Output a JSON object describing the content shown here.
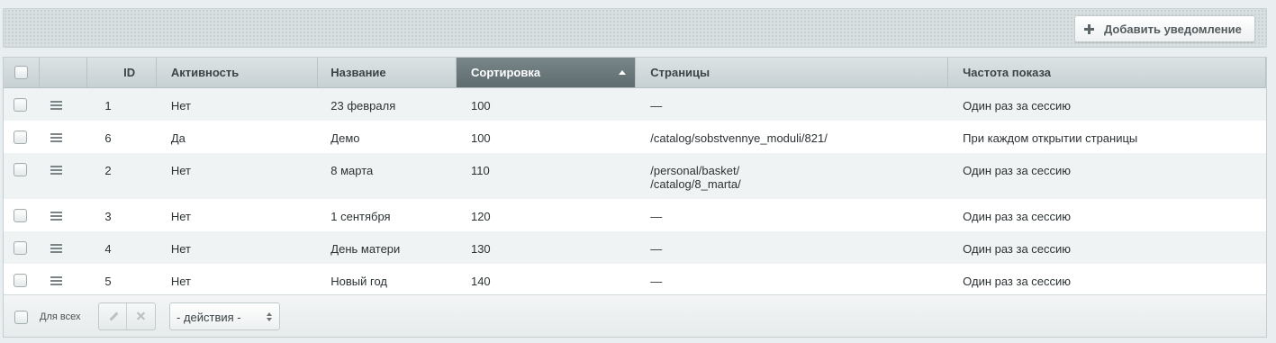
{
  "toolbar": {
    "add_button_label": "Добавить уведомление",
    "add_button_icon": "plus-icon"
  },
  "table": {
    "columns": [
      "ID",
      "Активность",
      "Название",
      "Сортировка",
      "Страницы",
      "Частота показа"
    ],
    "sorted_column": "Сортировка",
    "sort_direction": "asc",
    "rows": [
      {
        "id": "1",
        "active": "Нет",
        "name": "23 февраля",
        "sort": "100",
        "pages": [
          "—"
        ],
        "frequency": "Один раз за сессию"
      },
      {
        "id": "6",
        "active": "Да",
        "name": "Демо",
        "sort": "100",
        "pages": [
          "/catalog/sobstvennye_moduli/821/"
        ],
        "frequency": "При каждом открытии страницы"
      },
      {
        "id": "2",
        "active": "Нет",
        "name": "8 марта",
        "sort": "110",
        "pages": [
          "/personal/basket/",
          "/catalog/8_marta/"
        ],
        "frequency": "Один раз за сессию"
      },
      {
        "id": "3",
        "active": "Нет",
        "name": "1 сентября",
        "sort": "120",
        "pages": [
          "—"
        ],
        "frequency": "Один раз за сессию"
      },
      {
        "id": "4",
        "active": "Нет",
        "name": "День матери",
        "sort": "130",
        "pages": [
          "—"
        ],
        "frequency": "Один раз за сессию"
      },
      {
        "id": "5",
        "active": "Нет",
        "name": "Новый год",
        "sort": "140",
        "pages": [
          "—"
        ],
        "frequency": "Один раз за сессию"
      }
    ]
  },
  "footer": {
    "for_all_label": "Для всех",
    "actions_select_value": "- действия -"
  }
}
